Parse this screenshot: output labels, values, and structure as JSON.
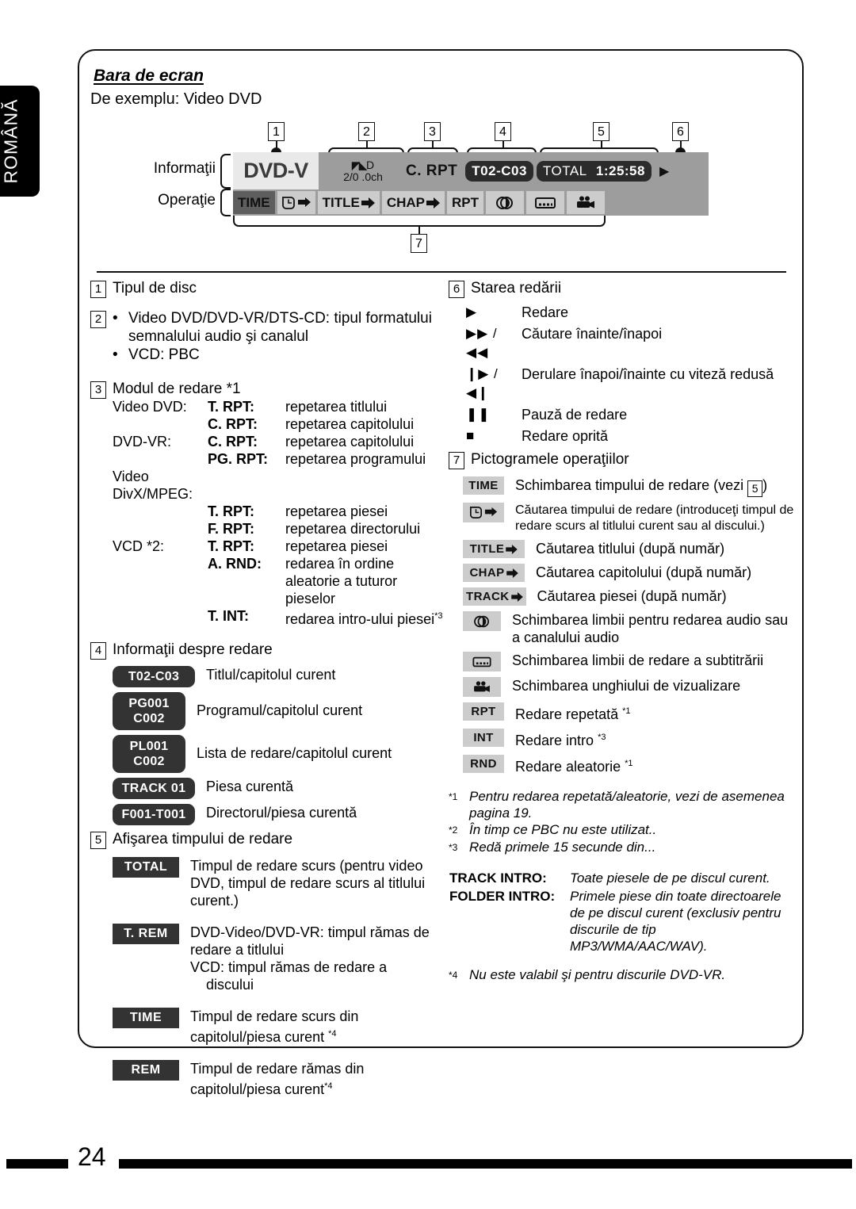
{
  "language_tab": "ROMÂNĂ",
  "page_number": "24",
  "header": {
    "section_title": "Bara de ecran",
    "example": "De exemplu: Video DVD"
  },
  "diagram": {
    "row_label_info": "Informaţii",
    "row_label_oper": "Operaţie",
    "callouts": [
      "1",
      "2",
      "3",
      "4",
      "5",
      "6",
      "7"
    ],
    "screenbar": {
      "disc_type": "DVD-V",
      "audio_format_line1": "D",
      "audio_format_line2": "2/0 .0ch",
      "play_mode": "C. RPT",
      "title_chapter": "T02-C03",
      "time_label": "TOTAL",
      "time_value": "1:25:58",
      "play_state_icon": "play-icon",
      "ops": [
        {
          "label": "TIME",
          "name": "time-button",
          "selected": true
        },
        {
          "label": "clock-arrow-icon",
          "name": "time-search-button",
          "icon": true
        },
        {
          "label": "TITLE",
          "name": "title-search-button",
          "arrow": true
        },
        {
          "label": "CHAP",
          "name": "chapter-search-button",
          "arrow": true
        },
        {
          "label": "RPT",
          "name": "repeat-button"
        },
        {
          "label": "audio-icon",
          "name": "audio-button",
          "icon": true
        },
        {
          "label": "subtitle-icon",
          "name": "subtitle-button",
          "icon": true
        },
        {
          "label": "angle-icon",
          "name": "angle-button",
          "icon": true
        }
      ]
    }
  },
  "left_column": {
    "item1": {
      "num": "1",
      "title": "Tipul de disc"
    },
    "item2": {
      "num": "2",
      "bullets": [
        "Video DVD/DVD-VR/DTS-CD: tipul formatului semnalului audio şi canalul",
        "VCD: PBC"
      ]
    },
    "item3": {
      "num": "3",
      "title": "Modul de redare *1",
      "rows": [
        {
          "disc": "Video DVD:",
          "code": "T. RPT",
          "desc": "repetarea titlului"
        },
        {
          "disc": "",
          "code": "C. RPT",
          "desc": "repetarea capitolului"
        },
        {
          "disc": "DVD-VR:",
          "code": "C. RPT",
          "desc": "repetarea capitolului"
        },
        {
          "disc": "",
          "code": "PG. RPT",
          "desc": "repetarea programului"
        },
        {
          "disc": "Video DivX/MPEG:",
          "code": "",
          "desc": ""
        },
        {
          "disc": "",
          "code": "T. RPT",
          "desc": "repetarea piesei"
        },
        {
          "disc": "",
          "code": "F. RPT",
          "desc": "repetarea directorului"
        },
        {
          "disc": "VCD *2:",
          "code": "T. RPT",
          "desc": "repetarea piesei"
        },
        {
          "disc": "",
          "code": "A. RND",
          "desc": "redarea în ordine aleatorie a tuturor pieselor"
        },
        {
          "disc": "",
          "code": "T. INT",
          "desc": "redarea intro-ului piesei*3"
        }
      ]
    },
    "item4": {
      "num": "4",
      "title": "Informaţii despre redare",
      "badges": [
        {
          "name": "title-chapter-badge",
          "lines": [
            "T02-C03"
          ],
          "label": "Titlul/capitolul curent",
          "shape": "pill-wide"
        },
        {
          "name": "program-chapter-badge",
          "lines": [
            "PG001",
            "C002"
          ],
          "label": "Programul/capitolul curent",
          "shape": "pill-two"
        },
        {
          "name": "playlist-chapter-badge",
          "lines": [
            "PL001",
            "C002"
          ],
          "label": "Lista de redare/capitolul curent",
          "shape": "pill-two"
        },
        {
          "name": "track-badge",
          "lines": [
            "TRACK 01"
          ],
          "label": "Piesa curentă",
          "shape": "pill-wide"
        },
        {
          "name": "folder-track-badge",
          "lines": [
            "F001-T001"
          ],
          "label": "Directorul/piesa curentă",
          "shape": "pill-wide"
        }
      ]
    },
    "item5": {
      "num": "5",
      "title": "Afişarea timpului de redare",
      "badges": [
        {
          "name": "total-time-badge",
          "label": "TOTAL",
          "desc": "Timpul de redare scurs (pentru video DVD, timpul de redare scurs al titlului curent.)"
        },
        {
          "name": "title-remain-badge",
          "label": "T. REM",
          "desc": "DVD-Video/DVD-VR: timpul rămas de redare a titlului\nVCD: timpul rămas de redare a discului"
        },
        {
          "name": "time-badge",
          "label": "TIME",
          "desc": "Timpul de redare scurs din capitolul/piesa curent *4"
        },
        {
          "name": "remain-badge",
          "label": "REM",
          "desc": "Timpul de redare rămas din capitolul/piesa curent*4"
        }
      ]
    }
  },
  "right_column": {
    "item6": {
      "num": "6",
      "title": "Starea redării",
      "states": [
        {
          "icon": "play-icon",
          "glyph": "▶",
          "label": "Redare"
        },
        {
          "icon": "fast-forward-rewind-icon",
          "glyph": "▶▶ / ◀◀",
          "label": "Căutare înainte/înapoi"
        },
        {
          "icon": "slow-forward-reverse-icon",
          "glyph": "❙▶ / ◀❙",
          "label": "Derulare înapoi/înainte cu viteză redusă"
        },
        {
          "icon": "pause-icon",
          "glyph": "❚❚",
          "label": "Pauză de redare"
        },
        {
          "icon": "stop-icon",
          "glyph": "■",
          "label": "Redare oprită"
        }
      ]
    },
    "item7": {
      "num": "7",
      "title": "Pictogramele operaţiilor",
      "ops": [
        {
          "key": "TIME",
          "name": "time-key",
          "text_before": "Schimbarea timpului de redare (vezi ",
          "ref": "5",
          "text_after": ")",
          "kind": "ref"
        },
        {
          "key": "clock-arrow-icon",
          "name": "time-search-key",
          "text": "Căutarea timpului de redare (introduceţi timpul de redare scurs al titlului curent sau al discului.)",
          "kind": "icon",
          "small": true
        },
        {
          "key": "TITLE",
          "name": "title-key",
          "text": "Căutarea titlului (după număr)",
          "arrow": true
        },
        {
          "key": "CHAP",
          "name": "chapter-key",
          "text": "Căutarea capitolului (după număr)",
          "arrow": true
        },
        {
          "key": "TRACK",
          "name": "track-key",
          "text": "Căutarea piesei (după număr)",
          "arrow": true
        },
        {
          "key": "audio-icon",
          "name": "audio-key",
          "text": "Schimbarea limbii pentru redarea audio sau a canalului audio",
          "kind": "icon"
        },
        {
          "key": "subtitle-icon",
          "name": "subtitle-key",
          "text": "Schimbarea limbii de redare a subtitrării",
          "kind": "icon"
        },
        {
          "key": "angle-icon",
          "name": "angle-key",
          "text": "Schimbarea unghiului de vizualizare",
          "kind": "icon"
        },
        {
          "key": "RPT",
          "name": "repeat-key",
          "text": "Redare repetată *1"
        },
        {
          "key": "INT",
          "name": "intro-key",
          "text": "Redare intro *3"
        },
        {
          "key": "RND",
          "name": "random-key",
          "text": "Redare aleatorie *1"
        }
      ]
    },
    "footnotes": [
      {
        "mark": "*1",
        "text": "Pentru redarea repetată/aleatorie, vezi de asemenea pagina 19."
      },
      {
        "mark": "*2",
        "text": "În timp ce PBC nu este utilizat.."
      },
      {
        "mark": "*3",
        "text": "Redă primele 15 secunde din..."
      }
    ],
    "intro_table": [
      {
        "key": "TRACK INTRO:",
        "value": "Toate piesele de pe discul curent."
      },
      {
        "key": "FOLDER INTRO:",
        "value": "Primele piese din toate directoarele de pe discul curent (exclusiv pentru discurile de tip MP3/WMA/AAC/WAV)."
      }
    ],
    "footnote4": {
      "mark": "*4",
      "text": "Nu este valabil şi pentru discurile DVD-VR."
    }
  }
}
